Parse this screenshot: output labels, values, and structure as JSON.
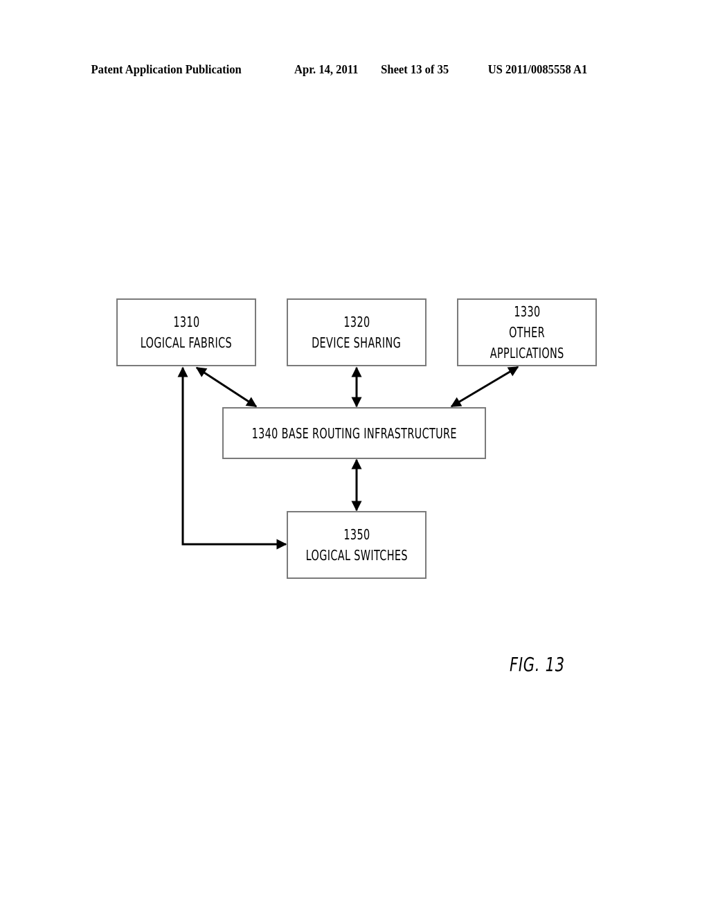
{
  "header": {
    "publication_type": "Patent Application Publication",
    "date": "Apr. 14, 2011",
    "sheet": "Sheet 13 of 35",
    "publication_number": "US 2011/0085558 A1"
  },
  "diagram": {
    "nodes": [
      {
        "id": "1310",
        "ref": "1310",
        "lines": [
          "LOGICAL FABRICS"
        ]
      },
      {
        "id": "1320",
        "ref": "1320",
        "lines": [
          "DEVICE SHARING"
        ]
      },
      {
        "id": "1330",
        "ref": "1330",
        "lines": [
          "OTHER",
          "APPLICATIONS"
        ]
      },
      {
        "id": "1340",
        "ref": "1340",
        "label": "1340 BASE ROUTING INFRASTRUCTURE"
      },
      {
        "id": "1350",
        "ref": "1350",
        "lines": [
          "LOGICAL SWITCHES"
        ]
      }
    ],
    "edges": [
      {
        "from": "1310",
        "to": "1340",
        "direction": "bidirectional"
      },
      {
        "from": "1320",
        "to": "1340",
        "direction": "bidirectional"
      },
      {
        "from": "1330",
        "to": "1340",
        "direction": "bidirectional"
      },
      {
        "from": "1340",
        "to": "1350",
        "direction": "bidirectional"
      },
      {
        "from": "1310",
        "to": "1350",
        "direction": "bidirectional",
        "routing": "elbow"
      }
    ]
  },
  "figure_label": "FIG. 13"
}
